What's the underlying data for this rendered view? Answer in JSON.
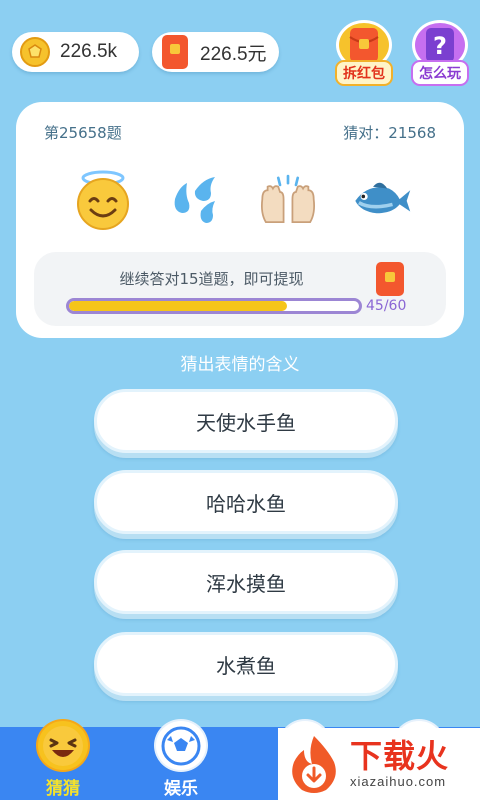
{
  "top_bar": {
    "coins": "226.5k",
    "cash": "226.5元",
    "red_packet_label": "拆红包",
    "how_to_play_label": "怎么玩"
  },
  "question": {
    "number": "第25658题",
    "correct_count": "猜对：21568",
    "emojis": [
      "smiling-face-with-halo",
      "sweat-droplets",
      "raising-hands",
      "fish"
    ]
  },
  "progress": {
    "text": "继续答对15道题，即可提现",
    "label": "45/60",
    "value": 45,
    "max": 60
  },
  "prompt": "猜出表情的含义",
  "answers": [
    "天使水手鱼",
    "哈哈水鱼",
    "浑水摸鱼",
    "水煮鱼"
  ],
  "bottom_nav": {
    "items": [
      {
        "label": "猜猜",
        "icon": "laughing-face-icon",
        "active": true
      },
      {
        "label": "娱乐",
        "icon": "soccer-ball-icon",
        "active": false
      }
    ]
  },
  "watermark": {
    "main": "下载火",
    "sub": "xiazaihuo.com"
  },
  "colors": {
    "background": "#8ccff2",
    "nav": "#3a86f2",
    "progress_fill": "#f5c51a",
    "accent_red": "#f3572e"
  }
}
